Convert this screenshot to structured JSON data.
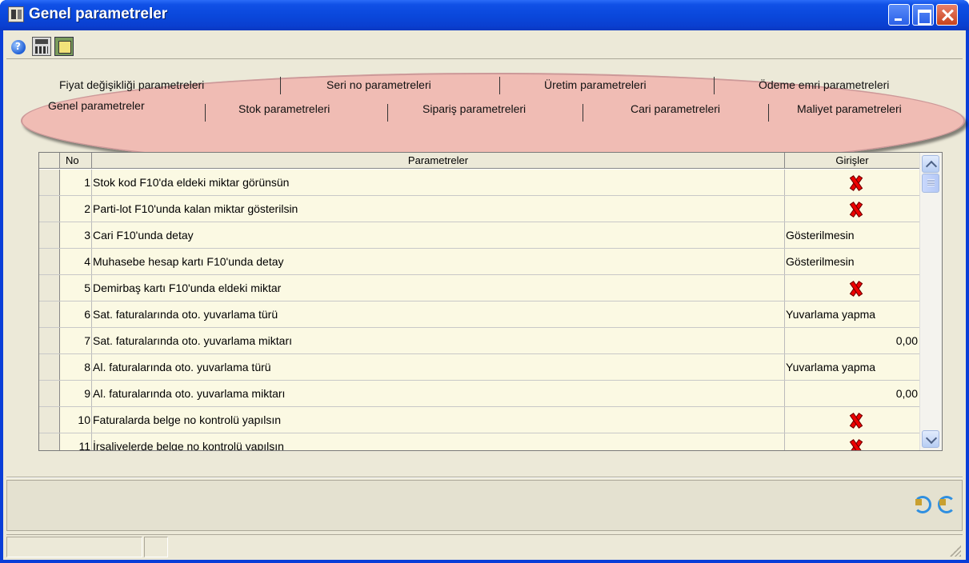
{
  "window": {
    "title": "Genel parametreler"
  },
  "toolbar": {
    "icons": [
      "help-icon",
      "calculator-icon",
      "form-icon"
    ]
  },
  "tabs": {
    "row1": [
      {
        "label": "Fiyat değişikliği parametreleri"
      },
      {
        "label": "Seri no parametreleri"
      },
      {
        "label": "Üretim parametreleri"
      },
      {
        "label": "Ödeme emri parametreleri"
      }
    ],
    "row2": [
      {
        "label": "Genel parametreler",
        "active": true
      },
      {
        "label": "Stok parametreleri"
      },
      {
        "label": "Sipariş parametreleri"
      },
      {
        "label": "Cari parametreleri"
      },
      {
        "label": "Maliyet parametreleri"
      }
    ]
  },
  "grid": {
    "headers": {
      "no": "No",
      "param": "Parametreler",
      "giris": "Girişler"
    },
    "rows": [
      {
        "no": "1",
        "param": "Stok kod F10'da eldeki miktar görünsün",
        "giris": "",
        "type": "check"
      },
      {
        "no": "2",
        "param": "Parti-lot F10'unda kalan miktar gösterilsin",
        "giris": "",
        "type": "check"
      },
      {
        "no": "3",
        "param": "Cari F10'unda detay",
        "giris": "Gösterilmesin",
        "type": "text"
      },
      {
        "no": "4",
        "param": "Muhasebe hesap kartı F10'unda detay",
        "giris": "Gösterilmesin",
        "type": "text"
      },
      {
        "no": "5",
        "param": "Demirbaş kartı F10'unda eldeki miktar",
        "giris": "",
        "type": "check"
      },
      {
        "no": "6",
        "param": "Sat. faturalarında oto. yuvarlama türü",
        "giris": "Yuvarlama yapma",
        "type": "text"
      },
      {
        "no": "7",
        "param": "Sat. faturalarında oto. yuvarlama miktarı",
        "giris": "0,00",
        "type": "number"
      },
      {
        "no": "8",
        "param": "Al. faturalarında oto. yuvarlama türü",
        "giris": "Yuvarlama yapma",
        "type": "text"
      },
      {
        "no": "9",
        "param": "Al. faturalarında oto. yuvarlama miktarı",
        "giris": "0,00",
        "type": "number"
      },
      {
        "no": "10",
        "param": "Faturalarda belge no kontrolü yapılsın",
        "giris": "",
        "type": "check"
      },
      {
        "no": "11",
        "param": "İrsaliyelerde belge no kontrolü yapılsın",
        "giris": "",
        "type": "check"
      }
    ]
  },
  "colors": {
    "titlebar": "#0a48dc",
    "tab_highlight": "#f0bcb4",
    "cell_bg": "#fbf9e3",
    "checkmark": "#e00000"
  }
}
